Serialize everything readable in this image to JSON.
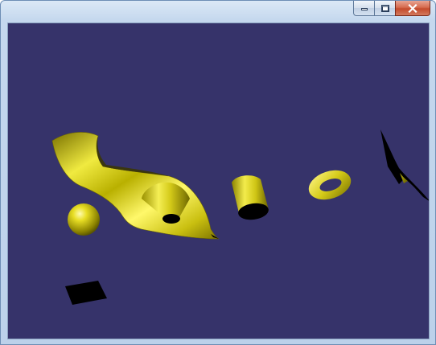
{
  "window": {
    "title": "",
    "controls": {
      "minimize_icon": "minimize-icon",
      "maximize_icon": "maximize-icon",
      "close_icon": "close-icon"
    }
  },
  "scene": {
    "background_color": "#36336a",
    "object_color": "#d8cf1a",
    "shadow_color": "#000000",
    "objects": [
      "surface",
      "cone",
      "sphere",
      "cylinder",
      "torus",
      "wedge",
      "box"
    ]
  }
}
